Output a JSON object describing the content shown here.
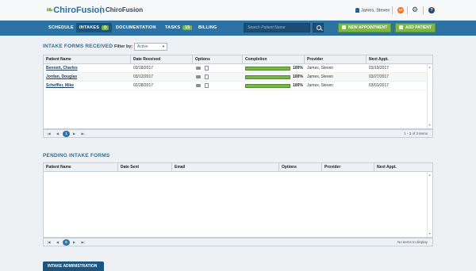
{
  "app": {
    "logo": "ChiroFusion",
    "clinic": "ChiroFusion"
  },
  "header": {
    "user_name": "James, Steven",
    "notification_count": "10",
    "help_label": "?"
  },
  "nav": {
    "items": [
      {
        "label": "SCHEDULE"
      },
      {
        "label": "INTAKES",
        "count": "0"
      },
      {
        "label": "DOCUMENTATION"
      },
      {
        "label": "TASKS",
        "count": "15"
      },
      {
        "label": "BILLING"
      }
    ],
    "search_placeholder": "Search Patient Name",
    "new_appointment": "NEW APPOINTMENT",
    "add_patient": "ADD PATIENT"
  },
  "received": {
    "title": "INTAKE FORMS RECEIVED",
    "filter_label": "Filter by:",
    "filter_value": "Active",
    "columns": [
      "Patient Name",
      "Date Received",
      "Options",
      "Completion",
      "Provider",
      "Next Appt."
    ],
    "rows": [
      {
        "name": "Bennett, Charles",
        "date": "03/18/2017",
        "completion": "100%",
        "completion_value": 1.0,
        "provider": "James, Steven",
        "next": "03/19/2017"
      },
      {
        "name": "Jordan, Douglas",
        "date": "03/12/2017",
        "completion": "100%",
        "completion_value": 1.0,
        "provider": "James, Steven",
        "next": "03/27/2017"
      },
      {
        "name": "Scheffler, Mike",
        "date": "02/28/2017",
        "completion": "100%",
        "completion_value": 1.0,
        "provider": "James, Steven",
        "next": "03/01/2017"
      }
    ],
    "pager": {
      "current_page": "1",
      "info": "1 - 3 of 3 items"
    }
  },
  "pending": {
    "title": "PENDING INTAKE FORMS",
    "columns": [
      "Patient Name",
      "Date Sent",
      "Email",
      "Options",
      "Provider",
      "Next Appt."
    ],
    "pager": {
      "current_page": "0",
      "info": "No items to display"
    }
  },
  "footer": {
    "intake_admin": "INTAKE ADMINISTRATION"
  },
  "colors": {
    "brand_blue": "#2c73a4",
    "accent_green": "#7ab648",
    "dark_navy": "#1b557f",
    "notification_orange": "#e57327"
  },
  "icons": [
    "leaf-icon",
    "user-icon",
    "gear-icon",
    "help-icon",
    "search-icon",
    "calendar-plus-icon",
    "add-user-icon",
    "folder-icon",
    "document-icon"
  ]
}
